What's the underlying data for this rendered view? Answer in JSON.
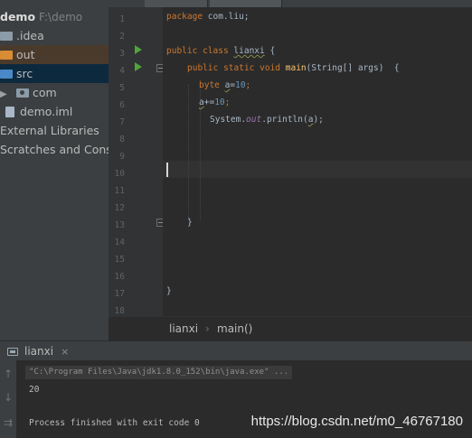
{
  "project_tree": {
    "root_name": "demo",
    "root_path": "F:\\demo",
    "items": [
      {
        "label": ".idea"
      },
      {
        "label": "out"
      },
      {
        "label": "src"
      },
      {
        "label": "com"
      },
      {
        "label": "demo.iml"
      },
      {
        "label": "External Libraries"
      },
      {
        "label": "Scratches and Consoles"
      }
    ]
  },
  "editor": {
    "line_numbers": [
      "1",
      "2",
      "3",
      "4",
      "5",
      "6",
      "7",
      "8",
      "9",
      "10",
      "11",
      "12",
      "13",
      "14",
      "15",
      "16",
      "17",
      "18"
    ],
    "code": {
      "l1_kw": "package",
      "l1_rest": " com.liu;",
      "l3_kw1": "public",
      "l3_kw2": "class",
      "l3_name": "lianxi",
      "l3_rest": " {",
      "l4_kw1": "public",
      "l4_kw2": "static",
      "l4_kw3": "void",
      "l4_fn": "main",
      "l4_rest": "(String[] args)  {",
      "l5_kw": "byte",
      "l5_var": "a",
      "l5_op": "=",
      "l5_num": "10",
      "l5_end": ";",
      "l6_var": "a",
      "l6_op": "+=",
      "l6_num": "10",
      "l6_end": ";",
      "l7_a": "System.",
      "l7_out": "out",
      "l7_b": ".println(",
      "l7_var": "a",
      "l7_c": ");",
      "l14": "}",
      "l17": "}"
    }
  },
  "breadcrumb": {
    "class_name": "lianxi",
    "separator": "›",
    "method": "main()"
  },
  "run_panel": {
    "tab_label": "lianxi",
    "close_glyph": "×",
    "command": "\"C:\\Program Files\\Java\\jdk1.8.0_152\\bin\\java.exe\" ...",
    "output": "20",
    "exit_message": "Process finished with exit code 0",
    "watermark": "https://blog.csdn.net/m0_46767180",
    "tools": {
      "up": "↑",
      "down": "↓",
      "wrap": "⇉"
    }
  },
  "colors": {
    "keyword": "#cc7832",
    "method": "#ffc66d",
    "number": "#6897bb",
    "static_field": "#9876aa",
    "run_arrow": "#4fa43b"
  }
}
